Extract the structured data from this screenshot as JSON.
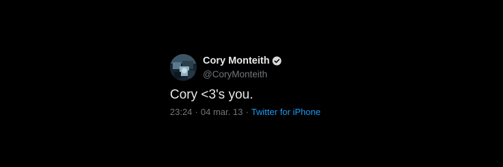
{
  "user": {
    "name": "Cory Monteith",
    "handle": "@CoryMonteith",
    "avatar_icon": "profile-photo",
    "verified_icon": "verified-badge-icon"
  },
  "tweet": {
    "text": "Cory <3's you.",
    "time": "23:24",
    "date": "04 mar. 13",
    "separator": "·",
    "source": "Twitter for iPhone"
  },
  "colors": {
    "background": "#000000",
    "text": "#e7e9ea",
    "secondary": "#71767b",
    "link": "#1d9bf0"
  }
}
